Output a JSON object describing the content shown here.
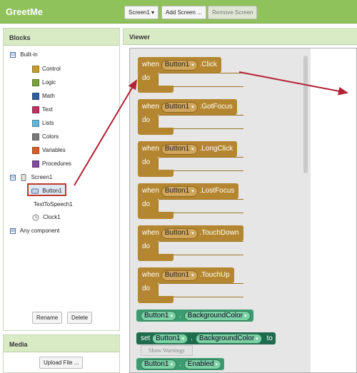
{
  "app": {
    "title": "GreetMe"
  },
  "toolbar": {
    "screen_select": "Screen1",
    "screen_select_arrow": "▾",
    "add_screen": "Add Screen ...",
    "remove_screen": "Remove Screen"
  },
  "blocks": {
    "header": "Blocks",
    "builtin": {
      "toggle": "⊟",
      "label": "Built-in",
      "items": [
        {
          "label": "Control",
          "color": "#c49b2d"
        },
        {
          "label": "Logic",
          "color": "#79a23a"
        },
        {
          "label": "Math",
          "color": "#2f5fa0"
        },
        {
          "label": "Text",
          "color": "#c0315f"
        },
        {
          "label": "Lists",
          "color": "#5fb6d9"
        },
        {
          "label": "Colors",
          "color": "#7a7a7a"
        },
        {
          "label": "Variables",
          "color": "#d75c27"
        },
        {
          "label": "Procedures",
          "color": "#7f4b9c"
        }
      ]
    },
    "screen": {
      "toggle": "⊟",
      "label": "Screen1",
      "children": [
        {
          "label": "Button1",
          "icon": "button-icon",
          "selected": true
        },
        {
          "label": "TextToSpeech1",
          "icon": "speech-icon"
        },
        {
          "label": "Clock1",
          "icon": "clock-icon"
        }
      ]
    },
    "any_component": {
      "toggle": "⊞",
      "label": "Any component"
    },
    "rename_label": "Rename",
    "delete_label": "Delete"
  },
  "media": {
    "header": "Media",
    "upload_label": "Upload File ..."
  },
  "viewer": {
    "header": "Viewer",
    "event_blocks": [
      {
        "when": "when",
        "component": "Button1",
        "event": ".Click",
        "do": "do"
      },
      {
        "when": "when",
        "component": "Button1",
        "event": ".GotFocus",
        "do": "do"
      },
      {
        "when": "when",
        "component": "Button1",
        "event": ".LongClick",
        "do": "do"
      },
      {
        "when": "when",
        "component": "Button1",
        "event": ".LostFocus",
        "do": "do"
      },
      {
        "when": "when",
        "component": "Button1",
        "event": ".TouchDown",
        "do": "do"
      },
      {
        "when": "when",
        "component": "Button1",
        "event": ".TouchUp",
        "do": "do"
      }
    ],
    "getter_block": {
      "component": "Button1",
      "dot": ".",
      "property": "BackgroundColor"
    },
    "setter_block": {
      "set": "set",
      "component": "Button1",
      "dot": ".",
      "property": "BackgroundColor",
      "to": "to"
    },
    "getter_block2": {
      "component": "Button1",
      "dot": ".",
      "property": "Enabled"
    },
    "dropdown_arrow": "▾",
    "show_warnings": "Show Warnings"
  },
  "colors": {
    "topbar": "#8fc25a",
    "event_block": "#b4862f",
    "component_block": "#3d9b72",
    "arrow": "#b22234"
  }
}
